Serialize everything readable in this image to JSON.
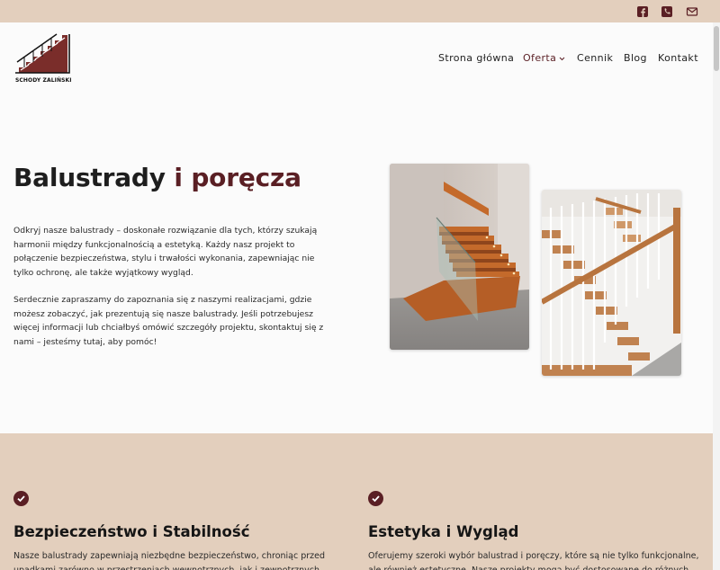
{
  "topbar": {
    "icons": [
      "facebook-icon",
      "phone-icon",
      "mail-icon"
    ]
  },
  "header": {
    "logo_text": "SCHODY ZALIŃSKI",
    "nav": [
      {
        "label": "Strona główna"
      },
      {
        "label": "Oferta"
      },
      {
        "label": "Cennik"
      },
      {
        "label": "Blog"
      },
      {
        "label": "Kontakt"
      }
    ]
  },
  "hero": {
    "title_main": "Balustrady",
    "title_accent": "i poręcza",
    "para1": "Odkryj nasze balustrady – doskonałe rozwiązanie dla tych, którzy szukają harmonii między funkcjonalnością a estetyką. Każdy nasz projekt to połączenie bezpieczeństwa, stylu i trwałości wykonania, zapewniając nie tylko ochronę, ale także wyjątkowy wygląd.",
    "para2": "Serdecznie zapraszamy do zapoznania się z naszymi realizacjami, gdzie możesz zobaczyć, jak prezentują się nasze balustrady. Jeśli potrzebujesz więcej informacji lub chciałbyś omówić szczegóły projektu, skontaktuj się z nami – jesteśmy tutaj, aby pomóc!"
  },
  "features": [
    {
      "title": "Bezpieczeństwo i Stabilność",
      "text": "Nasze balustrady zapewniają niezbędne bezpieczeństwo, chroniąc przed upadkami zarówno w przestrzeniach wewnętrznych, jak i zewnętrznych."
    },
    {
      "title": "Estetyka i Wygląd",
      "text": "Oferujemy szeroki wybór balustrad i poręczy, które są nie tylko funkcjonalne, ale również estetyczne. Nasze projekty mogą być dostosowane do różnych"
    }
  ],
  "colors": {
    "accent": "#5a1f24",
    "band": "#e3cfbd",
    "background": "#fbfbfb"
  }
}
